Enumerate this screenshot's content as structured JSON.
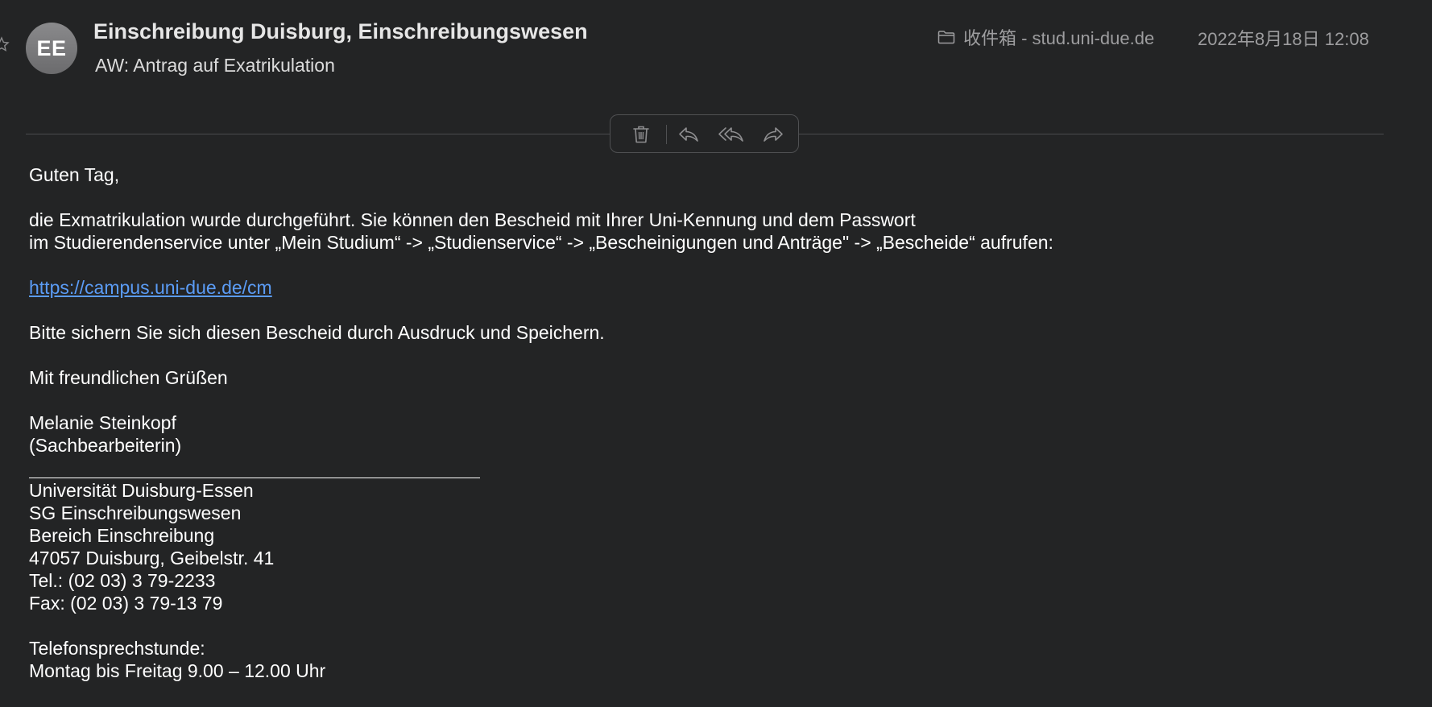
{
  "header": {
    "avatar_initials": "EE",
    "sender": "Einschreibung Duisburg, Einschreibungswesen",
    "subject": "AW: Antrag auf Exatrikulation",
    "mailbox": "收件箱 - stud.uni-due.de",
    "date": "2022年8月18日 12:08"
  },
  "toolbar": {
    "buttons": [
      {
        "name": "delete",
        "icon": "trash-icon"
      },
      {
        "name": "reply",
        "icon": "reply-icon"
      },
      {
        "name": "reply-all",
        "icon": "reply-all-icon"
      },
      {
        "name": "forward",
        "icon": "forward-icon"
      }
    ]
  },
  "message": {
    "greeting": "Guten Tag,",
    "para1_line1": "die Exmatrikulation wurde durchgeführt. Sie können den Bescheid mit Ihrer Uni-Kennung und dem Passwort",
    "para1_line2": "im Studierendenservice unter „Mein Studium“ -> „Studienservice“ -> „Bescheinigungen und Anträge\" -> „Bescheide“ aufrufen:",
    "link": "https://campus.uni-due.de/cm",
    "para2": "Bitte sichern Sie sich diesen Bescheid durch Ausdruck und Speichern.",
    "closing": "Mit freundlichen Grüßen",
    "name": "Melanie Steinkopf",
    "role": "(Sachbearbeiterin)",
    "signature": [
      "Universität Duisburg-Essen",
      "SG Einschreibungswesen",
      "Bereich Einschreibung",
      "47057 Duisburg, Geibelstr. 41",
      "Tel.: (02 03) 3 79-2233",
      "Fax: (02 03) 3 79-13 79"
    ],
    "hours_label": "Telefonsprechstunde:",
    "hours": "Montag bis Freitag 9.00 – 12.00 Uhr"
  },
  "colors": {
    "background": "#232425",
    "link": "#5b9cf6",
    "meta_text": "#9d9d9f"
  }
}
